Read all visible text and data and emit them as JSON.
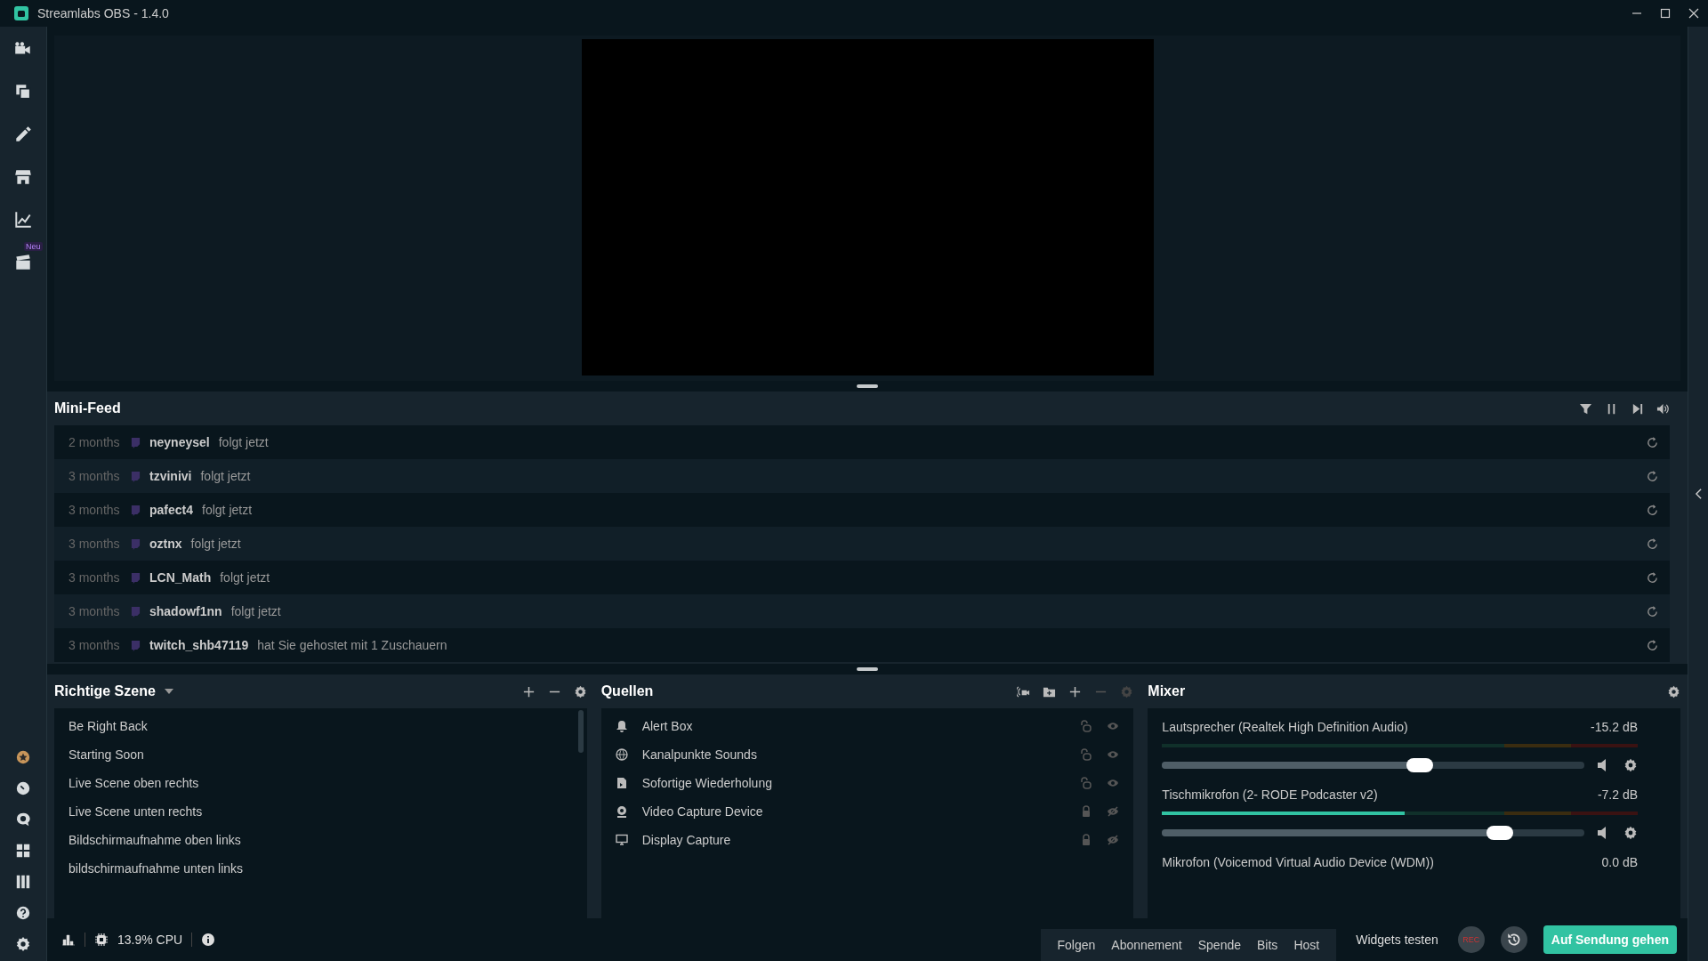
{
  "window": {
    "title": "Streamlabs OBS - 1.4.0"
  },
  "sidebar": {
    "top_items": [
      {
        "kind": "camera"
      },
      {
        "kind": "layout"
      },
      {
        "kind": "themes"
      },
      {
        "kind": "store"
      },
      {
        "kind": "chart"
      },
      {
        "kind": "clapper",
        "badge": "Neu"
      }
    ],
    "bottom_items": [
      {
        "kind": "prime"
      },
      {
        "kind": "dial"
      },
      {
        "kind": "chat"
      },
      {
        "kind": "grid"
      },
      {
        "kind": "columns"
      },
      {
        "kind": "help"
      },
      {
        "kind": "settings"
      }
    ]
  },
  "mini_feed": {
    "title": "Mini-Feed",
    "rows": [
      {
        "time": "2 months",
        "user": "neyneysel",
        "action": "folgt jetzt"
      },
      {
        "time": "3 months",
        "user": "tzvinivi",
        "action": "folgt jetzt"
      },
      {
        "time": "3 months",
        "user": "pafect4",
        "action": "folgt jetzt"
      },
      {
        "time": "3 months",
        "user": "oztnx",
        "action": "folgt jetzt"
      },
      {
        "time": "3 months",
        "user": "LCN_Math",
        "action": "folgt jetzt"
      },
      {
        "time": "3 months",
        "user": "shadowf1nn",
        "action": "folgt jetzt"
      },
      {
        "time": "3 months",
        "user": "twitch_shb47119",
        "action": "hat Sie gehostet mit 1 Zuschauern"
      }
    ]
  },
  "scenes": {
    "title": "Richtige Szene",
    "items": [
      "Be Right Back",
      "Starting Soon",
      "Live Scene oben rechts",
      "Live Scene unten rechts",
      "Bildschirmaufnahme oben links",
      "bildschirmaufnahme unten links"
    ]
  },
  "sources": {
    "title": "Quellen",
    "items": [
      {
        "kind": "alert",
        "name": "Alert Box",
        "locked": false,
        "visible": true
      },
      {
        "kind": "browser",
        "name": "Kanalpunkte Sounds",
        "locked": false,
        "visible": true
      },
      {
        "kind": "media",
        "name": "Sofortige Wiederholung",
        "locked": false,
        "visible": true
      },
      {
        "kind": "webcam",
        "name": "Video Capture Device",
        "locked": true,
        "visible": false
      },
      {
        "kind": "display",
        "name": "Display Capture",
        "locked": true,
        "visible": false
      }
    ]
  },
  "mixer": {
    "title": "Mixer",
    "channels": [
      {
        "name": "Lautsprecher (Realtek High Definition Audio)",
        "reading": "-15.2 dB",
        "meter": {
          "level": 0
        },
        "volume": {
          "level": 0.61
        }
      },
      {
        "name": "Tischmikrofon (2- RODE Podcaster v2)",
        "reading": "-7.2 dB",
        "meter": {
          "level": 0.51
        },
        "volume": {
          "level": 0.8
        }
      },
      {
        "name": "Mikrofon (Voicemod Virtual Audio Device (WDM))",
        "reading": "0.0 dB"
      }
    ]
  },
  "footer": {
    "cpu": "13.9% CPU",
    "test_buttons": [
      "Folgen",
      "Abonnement",
      "Spende",
      "Bits",
      "Host"
    ],
    "test_label": "Widgets testen",
    "rec": "REC",
    "go_live": "Auf Sendung gehen"
  }
}
